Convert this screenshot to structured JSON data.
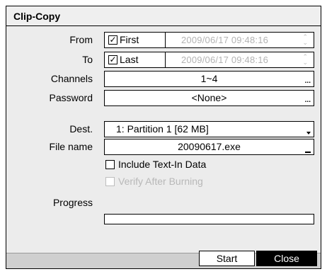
{
  "window": {
    "title": "Clip-Copy"
  },
  "rows": {
    "from": {
      "label": "From",
      "check_label": "First",
      "checked": true,
      "datetime": "2009/06/17  09:48:16"
    },
    "to": {
      "label": "To",
      "check_label": "Last",
      "checked": true,
      "datetime": "2009/06/17  09:48:16"
    },
    "channels": {
      "label": "Channels",
      "value": "1~4"
    },
    "password": {
      "label": "Password",
      "value": "<None>"
    },
    "dest": {
      "label": "Dest.",
      "value": "1: Partition 1 [62 MB]"
    },
    "filename": {
      "label": "File name",
      "value": "20090617.exe"
    }
  },
  "options": {
    "include_text": {
      "label": "Include Text-In Data",
      "checked": false
    },
    "verify": {
      "label": "Verify After Burning",
      "checked": false,
      "disabled": true
    }
  },
  "progress": {
    "label": "Progress",
    "percent": 0
  },
  "buttons": {
    "start": "Start",
    "close": "Close"
  },
  "icons": {
    "check": "check-icon",
    "spinner": "spinner-icon",
    "ellipsis": "ellipsis-icon",
    "dropdown": "dropdown-arrow-icon"
  },
  "glyphs": {
    "check": "✓",
    "spin_up": "⌃",
    "spin_down": "⌄",
    "ellipsis": "..."
  },
  "colors": {
    "close_button_bg": "#000000",
    "disabled_text": "#b3b3b3"
  }
}
